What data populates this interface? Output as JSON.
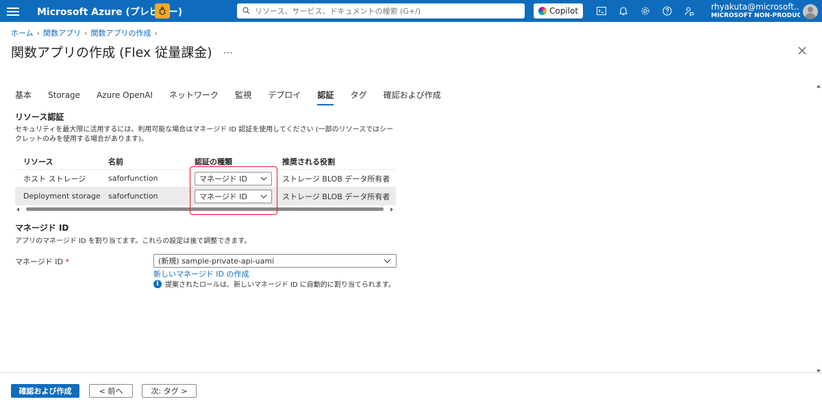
{
  "topbar": {
    "brand": "Microsoft Azure (プレビュー)",
    "search_placeholder": "リソース、サービス、ドキュメントの検索 (G+/)",
    "copilot_label": "Copilot",
    "user_name": "rhyakuta@microsoft.…",
    "user_org": "MICROSOFT NON-PRODUC…"
  },
  "breadcrumb": [
    "ホーム",
    "関数アプリ",
    "関数アプリの作成"
  ],
  "page_title": "関数アプリの作成 (Flex 従量課金)",
  "ellipsis": "…",
  "tabs": [
    {
      "label": "基本",
      "active": false
    },
    {
      "label": "Storage",
      "active": false
    },
    {
      "label": "Azure OpenAI",
      "active": false
    },
    {
      "label": "ネットワーク",
      "active": false
    },
    {
      "label": "監視",
      "active": false
    },
    {
      "label": "デプロイ",
      "active": false
    },
    {
      "label": "認証",
      "active": true
    },
    {
      "label": "タグ",
      "active": false
    },
    {
      "label": "確認および作成",
      "active": false
    }
  ],
  "resource_auth": {
    "heading": "リソース認証",
    "description": "セキュリティを最大限に活用するには、利用可能な場合はマネージド ID 認証を使用してください (一部のリソースではシークレットのみを使用する場合があります)。",
    "columns": [
      "リソース",
      "名前",
      "認証の種類",
      "推奨される役割"
    ],
    "rows": [
      {
        "resource": "ホスト ストレージ",
        "name": "saforfunction",
        "auth_type": "マネージド ID",
        "role": "ストレージ BLOB データ所有者"
      },
      {
        "resource": "Deployment storage",
        "name": "saforfunction",
        "auth_type": "マネージド ID",
        "role": "ストレージ BLOB データ所有者"
      }
    ]
  },
  "managed_id": {
    "heading": "マネージド ID",
    "description": "アプリのマネージド ID を割り当てます。これらの設定は後で調整できます。",
    "field_label": "マネージド ID",
    "required_mark": "*",
    "selected_value": "(新規) sample-private-api-uami",
    "create_link": "新しいマネージド ID の作成",
    "info_text": "提案されたロールは、新しいマネージド ID に自動的に割り当てられます。"
  },
  "footer": {
    "review_create": "確認および作成",
    "previous": "< 前へ",
    "next": "次: タグ >"
  },
  "colors": {
    "accent": "#0f6cbd",
    "highlight_box": "#e81123"
  }
}
